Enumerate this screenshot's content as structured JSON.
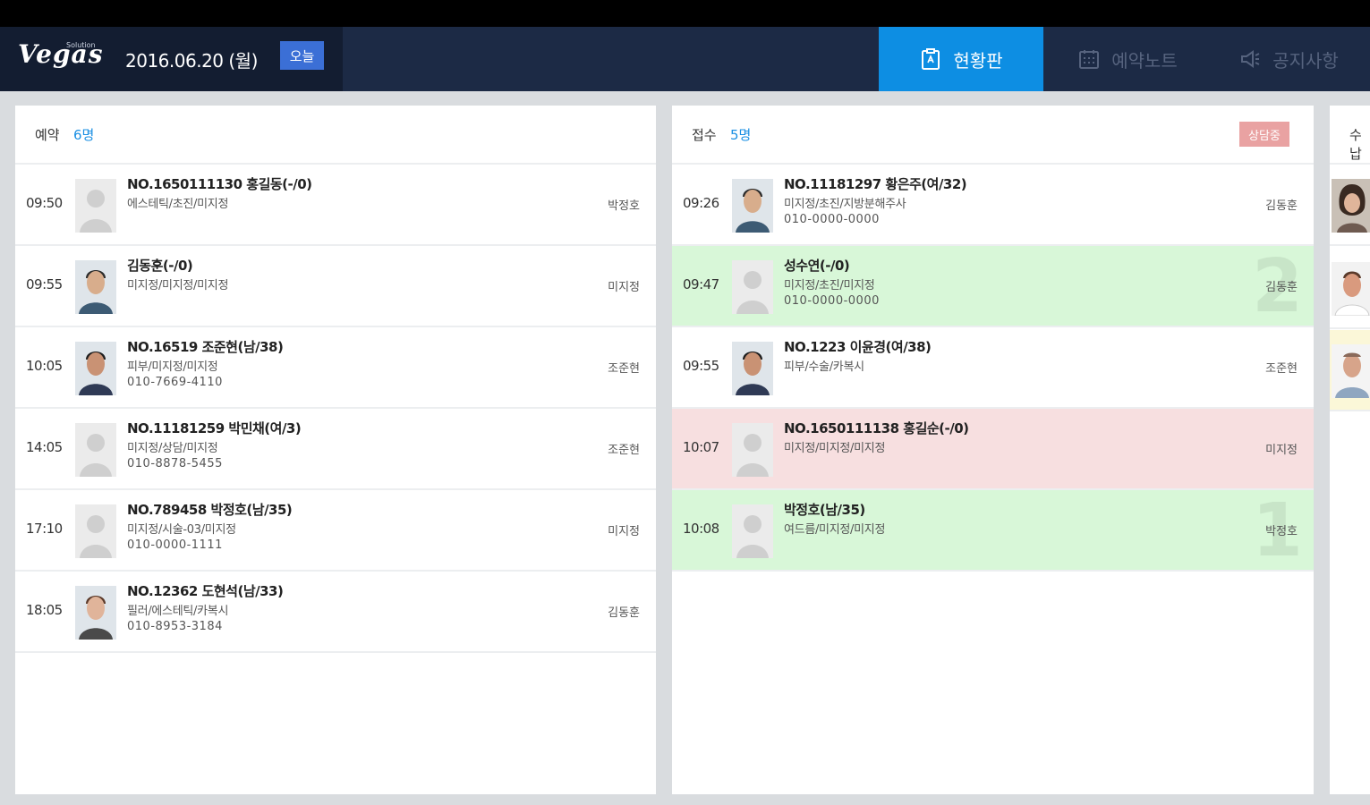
{
  "header": {
    "logo": "Vegas",
    "logo_super": "Solution",
    "date": "2016.06.20 (월)",
    "today_label": "오늘",
    "tabs": [
      {
        "label": "현황판",
        "icon": "clipboard-icon",
        "active": true
      },
      {
        "label": "예약노트",
        "icon": "calendar-icon",
        "active": false
      },
      {
        "label": "공지사항",
        "icon": "megaphone-icon",
        "active": false
      }
    ]
  },
  "colors": {
    "accent": "#0d8ee3",
    "header_bg": "#1c2a45",
    "row_checked": "#d8f7d8",
    "row_alert": "#f7dfe0"
  },
  "reservation": {
    "title": "예약",
    "count": "6명",
    "rows": [
      {
        "time": "09:50",
        "name": "NO.1650111130 홍길동(-/0)",
        "info": "에스테틱/초진/미지정",
        "phone": "",
        "staff": "박정호",
        "photo": "placeholder"
      },
      {
        "time": "09:55",
        "name": "김동훈(-/0)",
        "info": "미지정/미지정/미지정",
        "phone": "",
        "staff": "미지정",
        "photo": "photo"
      },
      {
        "time": "10:05",
        "name": "NO.16519 조준현(남/38)",
        "info": "피부/미지정/미지정",
        "phone": "010-7669-4110",
        "staff": "조준현",
        "photo": "photo"
      },
      {
        "time": "14:05",
        "name": "NO.11181259 박민채(여/3)",
        "info": "미지정/상담/미지정",
        "phone": "010-8878-5455",
        "staff": "조준현",
        "photo": "placeholder"
      },
      {
        "time": "17:10",
        "name": "NO.789458 박정호(남/35)",
        "info": "미지정/시술-03/미지정",
        "phone": "010-0000-1111",
        "staff": "미지정",
        "photo": "placeholder"
      },
      {
        "time": "18:05",
        "name": "NO.12362 도현석(남/33)",
        "info": "필러/에스테틱/카복시",
        "phone": "010-8953-3184",
        "staff": "김동훈",
        "photo": "photo"
      }
    ]
  },
  "reception": {
    "title": "접수",
    "count": "5명",
    "badge": "상담중",
    "rows": [
      {
        "time": "09:26",
        "name": "NO.11181297 황은주(여/32)",
        "info": "미지정/초진/지방분해주사",
        "phone": "010-0000-0000",
        "staff": "김동훈",
        "photo": "photo",
        "status": "normal",
        "bignum": ""
      },
      {
        "time": "09:47",
        "name": "성수연(-/0)",
        "info": "미지정/초진/미지정",
        "phone": "010-0000-0000",
        "staff": "김동훈",
        "photo": "placeholder",
        "status": "green",
        "bignum": "2"
      },
      {
        "time": "09:55",
        "name": "NO.1223 이윤경(여/38)",
        "info": "피부/수술/카복시",
        "phone": "",
        "staff": "조준현",
        "photo": "photo",
        "status": "normal",
        "bignum": ""
      },
      {
        "time": "10:07",
        "name": "NO.1650111138 홍길순(-/0)",
        "info": "미지정/미지정/미지정",
        "phone": "",
        "staff": "미지정",
        "photo": "placeholder",
        "status": "pink",
        "bignum": ""
      },
      {
        "time": "10:08",
        "name": "박정호(남/35)",
        "info": "여드름/미지정/미지정",
        "phone": "",
        "staff": "박정호",
        "photo": "placeholder",
        "status": "green",
        "bignum": "1"
      }
    ]
  },
  "third_panel": {
    "title": "수납"
  }
}
